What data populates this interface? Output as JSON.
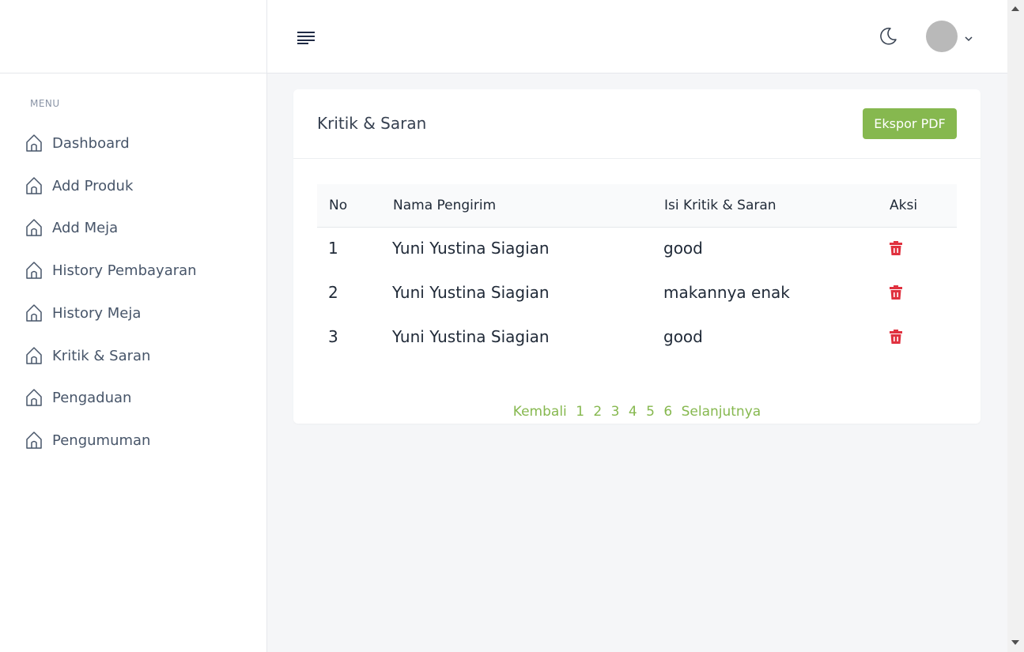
{
  "sidebar": {
    "menu_heading": "MENU",
    "items": [
      {
        "label": "Dashboard",
        "icon": "home-icon"
      },
      {
        "label": "Add Produk",
        "icon": "home-icon"
      },
      {
        "label": "Add Meja",
        "icon": "home-icon"
      },
      {
        "label": "History Pembayaran",
        "icon": "home-icon"
      },
      {
        "label": "History Meja",
        "icon": "home-icon"
      },
      {
        "label": "Kritik & Saran",
        "icon": "home-icon"
      },
      {
        "label": "Pengaduan",
        "icon": "home-icon"
      },
      {
        "label": "Pengumuman",
        "icon": "home-icon"
      }
    ]
  },
  "header": {
    "menu_icon": "hamburger-icon",
    "theme_icon": "moon-icon",
    "avatar_icon": "avatar",
    "chevron_icon": "chevron-down-icon"
  },
  "card": {
    "title": "Kritik & Saran",
    "export_label": "Ekspor PDF"
  },
  "table": {
    "columns": [
      "No",
      "Nama Pengirim",
      "Isi Kritik & Saran",
      "Aksi"
    ],
    "rows": [
      {
        "no": "1",
        "nama": "Yuni Yustina Siagian",
        "isi": "good",
        "aksi": "trash-icon"
      },
      {
        "no": "2",
        "nama": "Yuni Yustina Siagian",
        "isi": "makannya enak",
        "aksi": "trash-icon"
      },
      {
        "no": "3",
        "nama": "Yuni Yustina Siagian",
        "isi": "good",
        "aksi": "trash-icon"
      }
    ]
  },
  "pagination": {
    "prev": "Kembali",
    "pages": [
      "1",
      "2",
      "3",
      "4",
      "5",
      "6"
    ],
    "next": "Selanjutnya"
  },
  "colors": {
    "accent": "#86b84f",
    "danger": "#e0313f",
    "sidebar_text": "#475569"
  }
}
